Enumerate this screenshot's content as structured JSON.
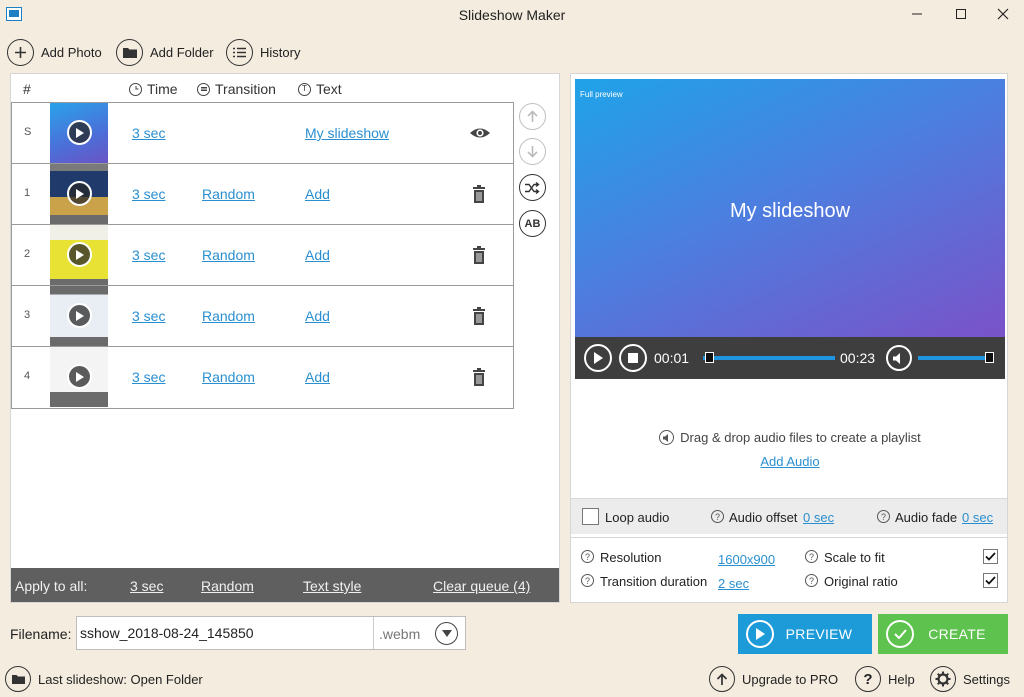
{
  "window": {
    "title": "Slideshow Maker",
    "controls": [
      "minimize",
      "maximize",
      "close"
    ]
  },
  "toolbar": {
    "add_photo": "Add Photo",
    "add_folder": "Add Folder",
    "history": "History"
  },
  "table": {
    "headers": {
      "index": "#",
      "time": "Time",
      "transition": "Transition",
      "text": "Text"
    },
    "rows": [
      {
        "index": "S",
        "time": "3 sec",
        "transition": "",
        "text": "My slideshow",
        "action_icon": "eye-icon"
      },
      {
        "index": "1",
        "time": "3 sec",
        "transition": "Random",
        "text": "Add",
        "action_icon": "trash-icon"
      },
      {
        "index": "2",
        "time": "3 sec",
        "transition": "Random",
        "text": "Add",
        "action_icon": "trash-icon"
      },
      {
        "index": "3",
        "time": "3 sec",
        "transition": "Random",
        "text": "Add",
        "action_icon": "trash-icon"
      },
      {
        "index": "4",
        "time": "3 sec",
        "transition": "Random",
        "text": "Add",
        "action_icon": "trash-icon"
      }
    ],
    "side_buttons": [
      "arrow-up-icon",
      "arrow-down-icon",
      "shuffle-icon",
      "ab-text-icon"
    ],
    "side_button_ab": "AB"
  },
  "apply_bar": {
    "label": "Apply to all:",
    "time": "3 sec",
    "transition": "Random",
    "text_style": "Text style",
    "clear_queue": "Clear queue (4)"
  },
  "preview": {
    "full_preview_label": "Full preview",
    "title": "My slideshow",
    "current_time": "00:01",
    "total_time": "00:23",
    "progress": 0.05,
    "volume": 1.0
  },
  "audio": {
    "hint": "Drag & drop audio files to create a playlist",
    "add_audio": "Add Audio",
    "loop_audio": "Loop audio",
    "loop_checked": false,
    "audio_offset_label": "Audio offset",
    "audio_offset_value": "0 sec",
    "audio_fade_label": "Audio fade",
    "audio_fade_value": "0 sec"
  },
  "settings": {
    "resolution_label": "Resolution",
    "resolution_value": "1600x900",
    "transition_duration_label": "Transition duration",
    "transition_duration_value": "2 sec",
    "scale_to_fit_label": "Scale to fit",
    "scale_to_fit_checked": true,
    "original_ratio_label": "Original ratio",
    "original_ratio_checked": true
  },
  "output": {
    "filename_label": "Filename:",
    "filename_value": "sshow_2018-08-24_145850",
    "extension": ".webm",
    "preview_button": "PREVIEW",
    "create_button": "CREATE"
  },
  "footer": {
    "last_slideshow": "Last slideshow: Open Folder",
    "upgrade": "Upgrade to PRO",
    "help": "Help",
    "settings": "Settings"
  },
  "colors": {
    "background": "#f4ecdf",
    "link": "#2a8fd0",
    "preview_button": "#1d9ad8",
    "create_button": "#5ec24e",
    "apply_bar": "#5f5f5f"
  }
}
